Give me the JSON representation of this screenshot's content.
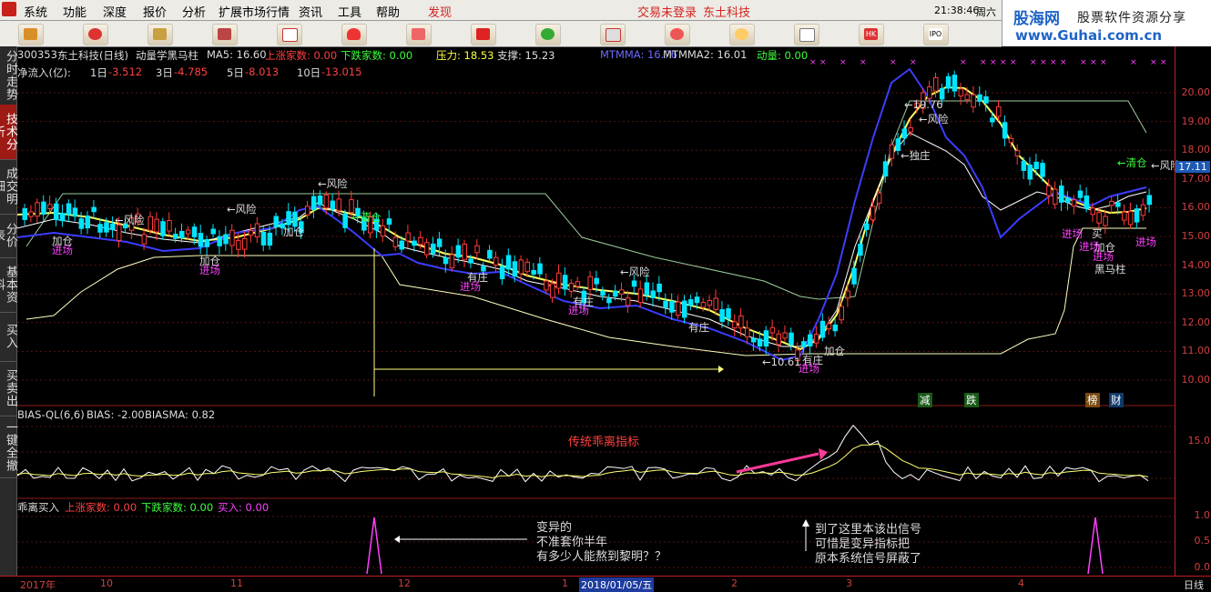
{
  "menubar": {
    "items": [
      "系统",
      "功能",
      "深度",
      "报价",
      "分析",
      "扩展市场行情",
      "资讯",
      "工具",
      "帮助"
    ],
    "discover": "发现",
    "login_status": "交易未登录",
    "stock_name": "东土科技",
    "clock": "21:38:46",
    "weekday": "周六"
  },
  "brand": {
    "logo": "股海网",
    "slogan": "股票软件资源分享",
    "url": "www.Guhai.com.cn"
  },
  "toolbar": {
    "icons": [
      "bar-chart-icon",
      "star-icon",
      "bars-icon",
      "grid-icon",
      "document-icon",
      "document-icon",
      "fire-icon",
      "up-arrow-icon",
      "calendar-icon",
      "users-icon",
      "window-icon",
      "magnify-icon",
      "target-icon",
      "news-icon",
      "hk-icon",
      "ipo-icon"
    ],
    "ipo_label": "IPO",
    "hk_label": "HK"
  },
  "sidetabs": [
    {
      "label": "分时走势",
      "active": false
    },
    {
      "label": "技术分析",
      "active": true
    },
    {
      "label": "成交明细",
      "active": false
    },
    {
      "label": "分价表",
      "active": false
    },
    {
      "label": "基本资料",
      "active": false
    },
    {
      "label": "买入",
      "active": false
    },
    {
      "label": "买卖出",
      "active": false
    },
    {
      "label": "一键全撤",
      "active": false
    }
  ],
  "header1": {
    "code": "300353",
    "name": "东土科技(日线)",
    "indicator": "动量学黑马柱",
    "ma5": "MA5: 16.60",
    "up_count": "上涨家数: 0.00",
    "down_count": "下跌家数: 0.00",
    "pressure": "压力: 18.53",
    "support": "支撑: 15.23",
    "mtmma": "MTMMA: 16.76",
    "mtmma2": "MTMMA2: 16.01",
    "momentum": "动量: 0.00"
  },
  "header2": {
    "label": "净流入(亿):",
    "d1": "1日",
    "d1v": "-3.512",
    "d3": "3日",
    "d3v": "-4.785",
    "d5": "5日",
    "d5v": "-8.013",
    "d10": "10日",
    "d10v": "-13.015"
  },
  "price_axis": [
    "20.00",
    "19.00",
    "18.00",
    "17.00",
    "16.00",
    "15.00",
    "14.00",
    "13.00",
    "12.00",
    "11.00",
    "10.00"
  ],
  "current_price": "17.11",
  "annotations": {
    "fengxian": "←风险",
    "jiacang": "加仓",
    "jinchang": "进场",
    "youzhuang": "有庄",
    "qingcang": "←清仓",
    "duzhu": "←独庄",
    "high": "←19.76",
    "low": "←10.61",
    "buy": "买",
    "heimazhu": "黑马柱",
    "jian": "减",
    "die": "跌",
    "bang": "榜",
    "cai": "财"
  },
  "bias_panel": {
    "title": "BIAS-QL(6,6)",
    "bias": "BIAS: -2.00",
    "biasma": "BIASMA: 0.82",
    "note": "传统乖离指标",
    "tick": "15.0"
  },
  "buy_panel": {
    "title": "乖离买入",
    "up": "上涨家数: 0.00",
    "down": "下跌家数: 0.00",
    "buy": "买入: 0.00",
    "note1": [
      "变异的",
      "不准套你半年",
      "有多少人能熬到黎明？？"
    ],
    "note2": [
      "到了这里本该出信号",
      "可惜是变异指标把",
      "原本系统信号屏蔽了"
    ],
    "ticks": [
      "1.0",
      "0.5",
      "0.0"
    ]
  },
  "date_axis": {
    "labels": [
      "2017年",
      "10",
      "11",
      "12",
      "1",
      "2",
      "3",
      "4"
    ],
    "cursor_date": "2018/01/05/五",
    "period": "日线"
  },
  "colors": {
    "bg": "#000000",
    "up": "#ff3a3a",
    "down": "#00e5ff",
    "ma_yellow": "#ffff60",
    "ma_blue": "#3c3cff",
    "ma_white": "#ffffff",
    "band_green": "#9acd9a",
    "band_yellow": "#ffffa0"
  }
}
